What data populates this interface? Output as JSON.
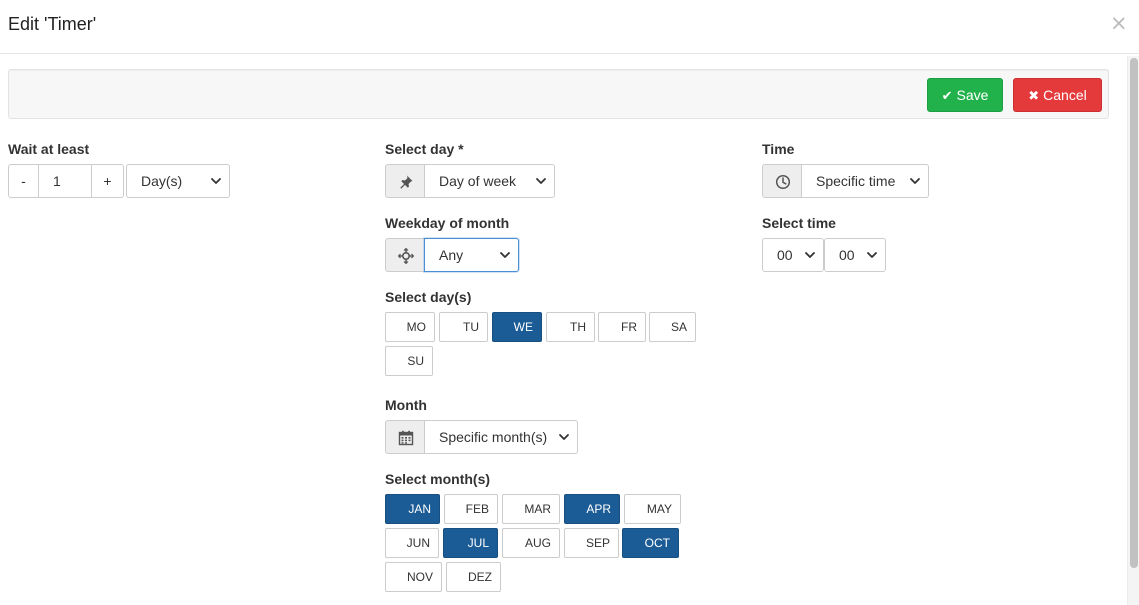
{
  "dialog": {
    "title": "Edit 'Timer'",
    "close_glyph": "×"
  },
  "toolbar": {
    "save_icon": "check-icon",
    "save_glyph": "✔",
    "save_label": "Save",
    "save_color": "#21b24c",
    "cancel_icon": "x-icon",
    "cancel_glyph": "✖",
    "cancel_label": "Cancel",
    "cancel_color": "#e43a3c"
  },
  "wait": {
    "label": "Wait at least",
    "minus": "-",
    "value": "1",
    "plus": "+",
    "unit": "Day(s)"
  },
  "select_day": {
    "label": "Select day *",
    "icon": "pin-icon",
    "value": "Day of week"
  },
  "weekday_of_month": {
    "label": "Weekday of month",
    "icon": "crosshair-icon",
    "value": "Any"
  },
  "days": {
    "label": "Select day(s)",
    "items": [
      {
        "label": "MO",
        "selected": false
      },
      {
        "label": "TU",
        "selected": false
      },
      {
        "label": "WE",
        "selected": true
      },
      {
        "label": "TH",
        "selected": false
      },
      {
        "label": "FR",
        "selected": false
      },
      {
        "label": "SA",
        "selected": false
      },
      {
        "label": "SU",
        "selected": false
      }
    ]
  },
  "month": {
    "label": "Month",
    "icon": "calendar-icon",
    "value": "Specific month(s)"
  },
  "months": {
    "label": "Select month(s)",
    "items": [
      {
        "label": "JAN",
        "selected": true
      },
      {
        "label": "FEB",
        "selected": false
      },
      {
        "label": "MAR",
        "selected": false
      },
      {
        "label": "APR",
        "selected": true
      },
      {
        "label": "MAY",
        "selected": false
      },
      {
        "label": "JUN",
        "selected": false
      },
      {
        "label": "JUL",
        "selected": true
      },
      {
        "label": "AUG",
        "selected": false
      },
      {
        "label": "SEP",
        "selected": false
      },
      {
        "label": "OCT",
        "selected": true
      },
      {
        "label": "NOV",
        "selected": false
      },
      {
        "label": "DEZ",
        "selected": false
      }
    ]
  },
  "time": {
    "label": "Time",
    "icon": "clock-icon",
    "value": "Specific time"
  },
  "select_time": {
    "label": "Select time",
    "hour": "00",
    "minute": "00"
  },
  "colors": {
    "selected_toggle": "#1c5c96",
    "focus_border": "#4a8fd6"
  }
}
